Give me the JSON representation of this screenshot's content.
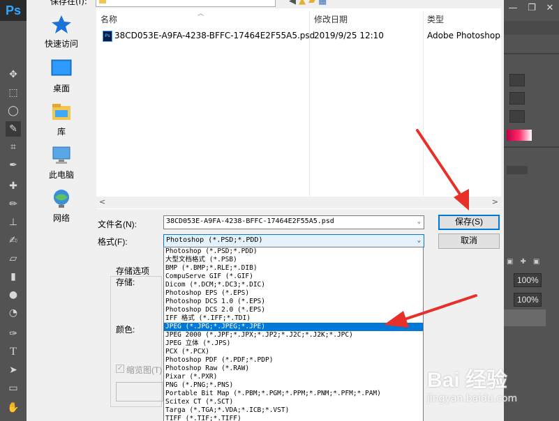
{
  "photoshop": {
    "logo": "Ps",
    "right_panel": {
      "zoom_1": "100%",
      "zoom_2": "100%"
    }
  },
  "dialog": {
    "save_in_label": "保存在(I):",
    "nav_icons": [
      "back-icon",
      "up-folder-icon",
      "new-folder-icon",
      "view-menu-icon"
    ],
    "places": [
      {
        "label": "快速访问",
        "icon": "star-icon"
      },
      {
        "label": "桌面",
        "icon": "desktop-icon"
      },
      {
        "label": "库",
        "icon": "library-icon"
      },
      {
        "label": "此电脑",
        "icon": "computer-icon"
      },
      {
        "label": "网络",
        "icon": "network-icon"
      }
    ],
    "columns": {
      "name": "名称",
      "modified": "修改日期",
      "type": "类型"
    },
    "file": {
      "name": "38CD053E-A9FA-4238-BFFC-17464E2F55A5.psd",
      "modified": "2019/9/25 12:10",
      "type": "Adobe Photoshop"
    },
    "filename_label": "文件名(N):",
    "filename_value": "38CD053E-A9FA-4238-BFFC-17464E2F55A5.psd",
    "format_label": "格式(F):",
    "format_value": "Photoshop (*.PSD;*.PDD)",
    "save_button": "保存(S)",
    "cancel_button": "取消",
    "save_options_label": "存储选项",
    "save_label": "存储:",
    "color_label": "颜色:",
    "thumbnail_label": "缩览图(T)",
    "format_options": [
      "Photoshop (*.PSD;*.PDD)",
      "大型文档格式 (*.PSB)",
      "BMP (*.BMP;*.RLE;*.DIB)",
      "CompuServe GIF (*.GIF)",
      "Dicom (*.DCM;*.DC3;*.DIC)",
      "Photoshop EPS (*.EPS)",
      "Photoshop DCS 1.0 (*.EPS)",
      "Photoshop DCS 2.0 (*.EPS)",
      "IFF 格式 (*.IFF;*.TDI)",
      "JPEG (*.JPG;*.JPEG;*.JPE)",
      "JPEG 2000 (*.JPF;*.JPX;*.JP2;*.J2C;*.J2K;*.JPC)",
      "JPEG 立体 (*.JPS)",
      "PCX (*.PCX)",
      "Photoshop PDF (*.PDF;*.PDP)",
      "Photoshop Raw (*.RAW)",
      "Pixar (*.PXR)",
      "PNG (*.PNG;*.PNS)",
      "Portable Bit Map (*.PBM;*.PGM;*.PPM;*.PNM;*.PFM;*.PAM)",
      "Scitex CT (*.SCT)",
      "Targa (*.TGA;*.VDA;*.ICB;*.VST)",
      "TIFF (*.TIF;*.TIFF)"
    ],
    "selected_option": "JPEG (*.JPG;*.JPEG;*.JPE)"
  },
  "watermark": {
    "logo": "Bai 经验",
    "url": "jingyan.baidu.com"
  },
  "colors": {
    "selection": "#0078d7",
    "arrow": "#e8302a",
    "ps_panel": "#535353"
  }
}
